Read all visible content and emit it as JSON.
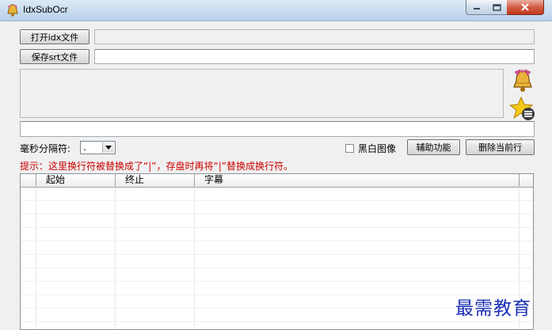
{
  "window": {
    "title": "IdxSubOcr"
  },
  "toolbar": {
    "open_idx_label": "打开idx文件",
    "save_srt_label": "保存srt文件",
    "idx_path": "",
    "srt_path": ""
  },
  "controls": {
    "ms_separator_label": "毫秒分隔符:",
    "ms_separator_value": ".",
    "bw_image_label": "黑白图像",
    "aux_button_label": "辅助功能",
    "delete_row_label": "删除当前行"
  },
  "hint": "提示：这里换行符被替换成了“|”，存盘时再将“|”替换成换行符。",
  "table": {
    "columns": [
      "起始",
      "终止",
      "字幕"
    ],
    "rows": []
  },
  "icons": {
    "app": "bell-icon",
    "side_top": "bell-icon",
    "side_bottom": "star-list-icon"
  },
  "watermark": "最需教育",
  "colors": {
    "hint": "#cc0000",
    "watermark": "#1a2fb5"
  }
}
